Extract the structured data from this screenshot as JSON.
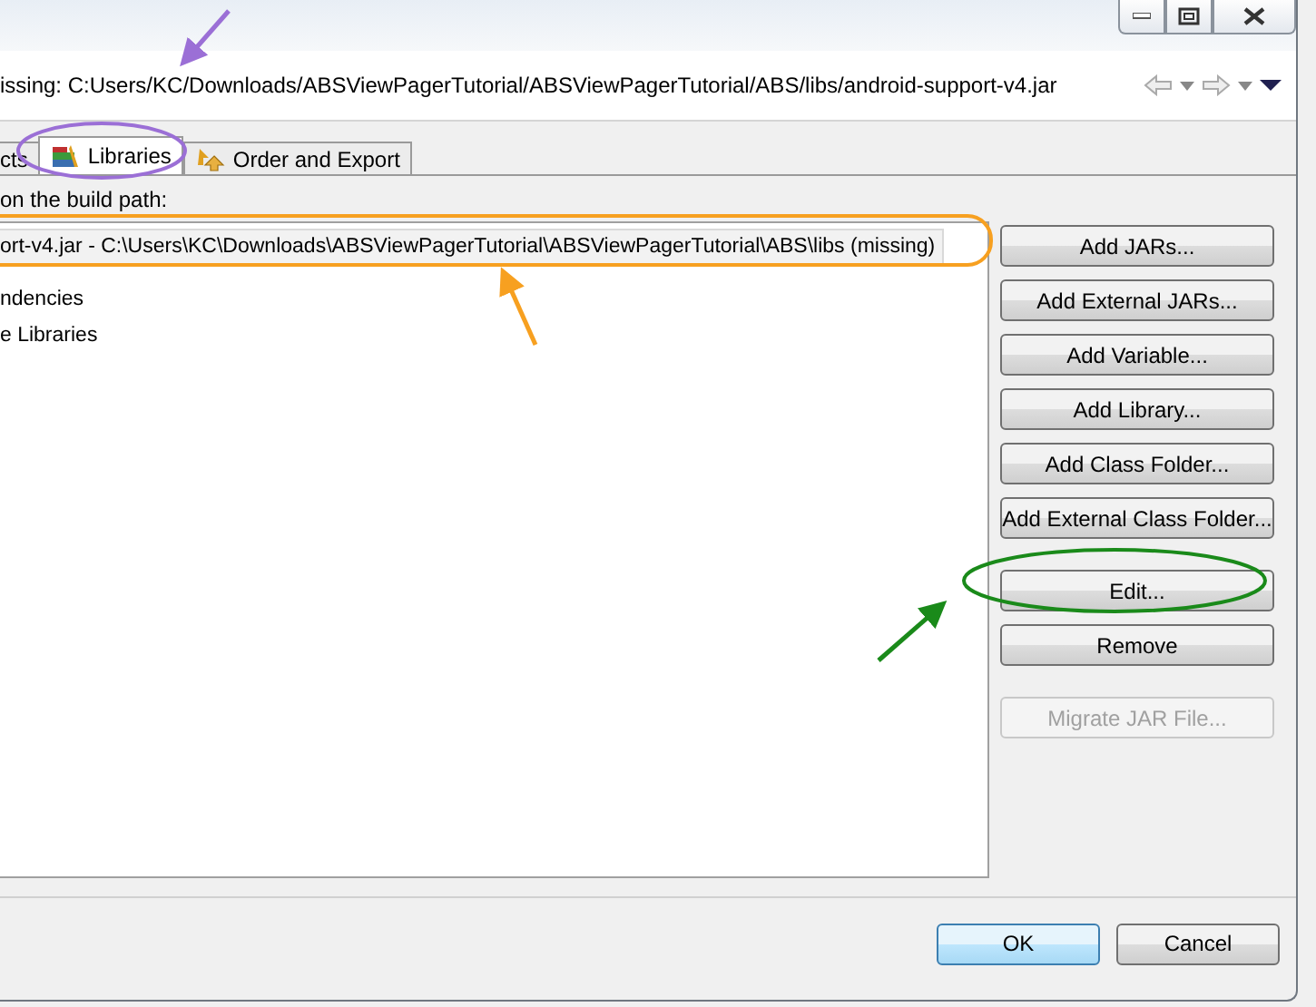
{
  "header": {
    "message": "issing: C:Users/KC/Downloads/ABSViewPagerTutorial/ABSViewPagerTutorial/ABS/libs/android-support-v4.jar"
  },
  "tabs": [
    {
      "label": "cts",
      "selected": false,
      "kind": "plain"
    },
    {
      "label": "Libraries",
      "selected": true,
      "kind": "books"
    },
    {
      "label": "Order and Export",
      "selected": false,
      "kind": "order"
    }
  ],
  "build_path_label": "on the build path:",
  "tree": [
    {
      "label": "ort-v4.jar - C:\\Users\\KC\\Downloads\\ABSViewPagerTutorial\\ABSViewPagerTutorial\\ABS\\libs (missing)",
      "selected": true
    },
    {
      "label": "ndencies",
      "selected": false
    },
    {
      "label": "e Libraries",
      "selected": false
    }
  ],
  "button_groups": [
    [
      {
        "label": "Add JARs...",
        "disabled": false
      },
      {
        "label": "Add External JARs...",
        "disabled": false
      },
      {
        "label": "Add Variable...",
        "disabled": false
      },
      {
        "label": "Add Library...",
        "disabled": false
      },
      {
        "label": "Add Class Folder...",
        "disabled": false
      },
      {
        "label": "Add External Class Folder...",
        "disabled": false
      }
    ],
    [
      {
        "label": "Edit...",
        "disabled": false
      },
      {
        "label": "Remove",
        "disabled": false
      }
    ],
    [
      {
        "label": "Migrate JAR File...",
        "disabled": true
      }
    ]
  ],
  "footer": [
    {
      "label": "OK",
      "default": true
    },
    {
      "label": "Cancel",
      "default": false
    }
  ]
}
